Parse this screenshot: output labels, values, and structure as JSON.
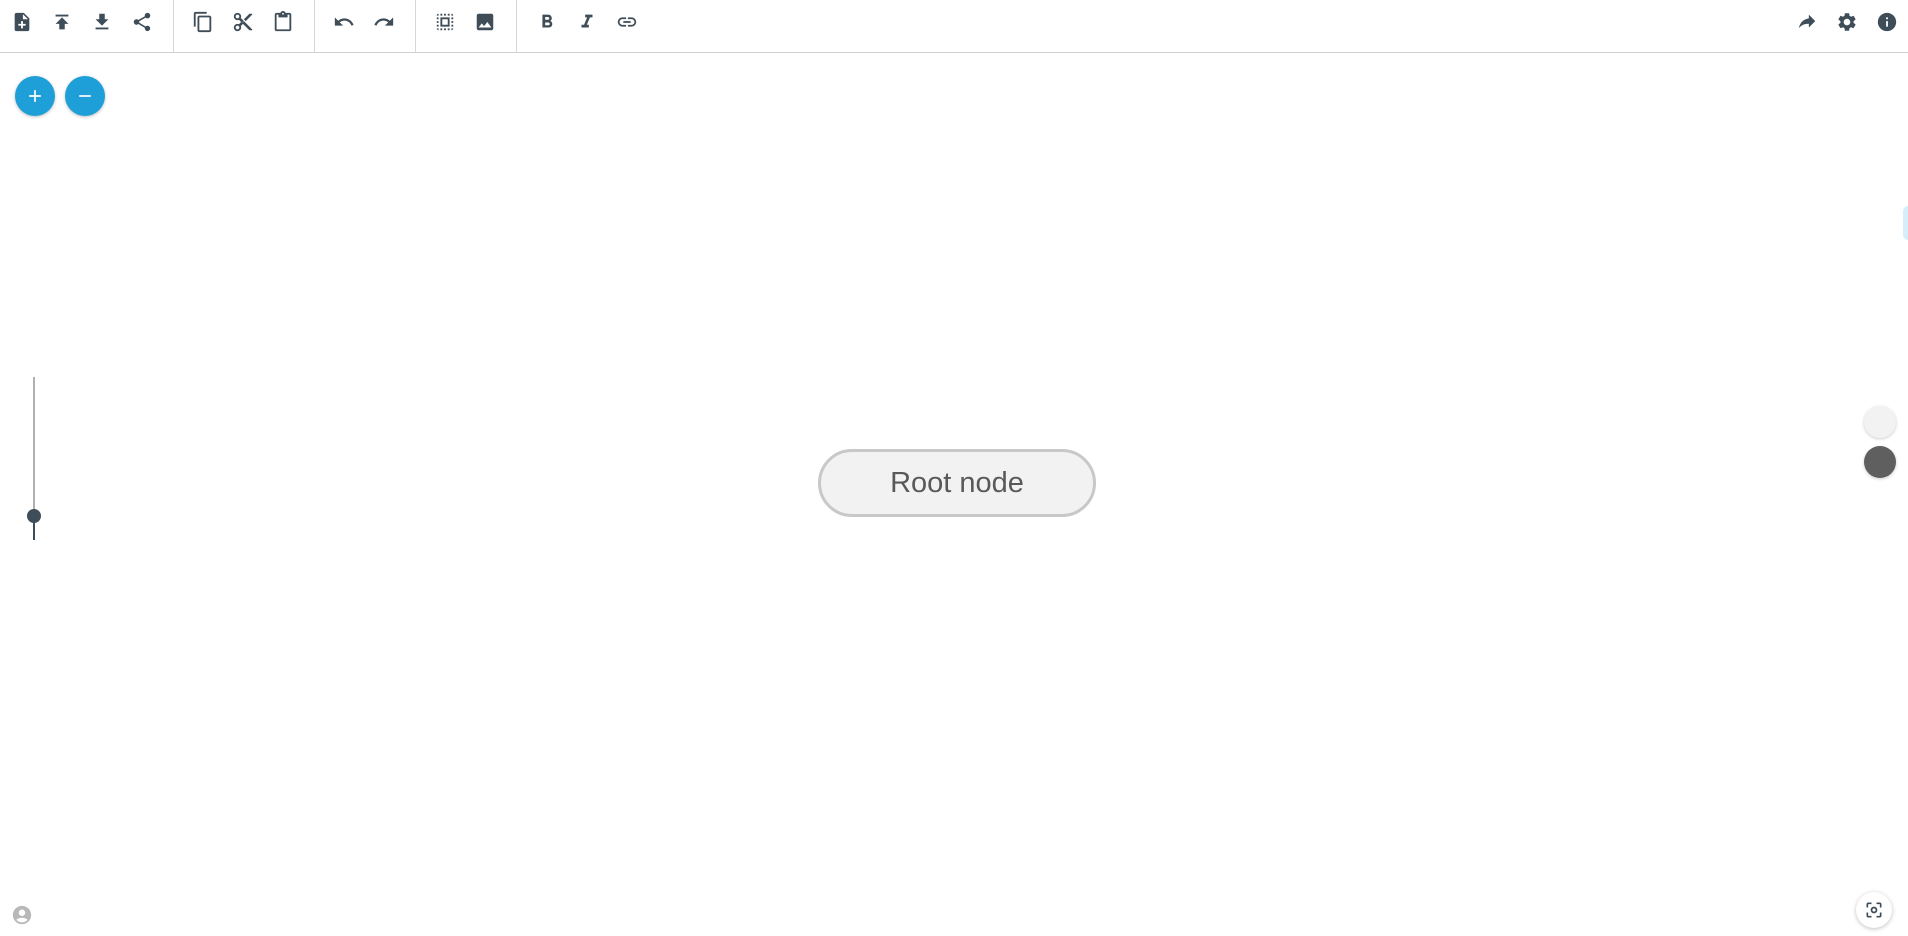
{
  "toolbar": {
    "groups": [
      {
        "name": "file",
        "items": [
          "new-map-icon",
          "upload-icon",
          "download-icon",
          "share-icon"
        ]
      },
      {
        "name": "clipboard",
        "items": [
          "copy-icon",
          "cut-icon",
          "paste-icon"
        ]
      },
      {
        "name": "history",
        "items": [
          "undo-icon",
          "redo-icon"
        ]
      },
      {
        "name": "insert",
        "items": [
          "select-all-icon",
          "image-icon"
        ]
      },
      {
        "name": "format",
        "items": [
          "bold-icon",
          "italic-icon",
          "link-icon"
        ]
      }
    ],
    "right_items": [
      "redo-forward-icon",
      "settings-icon",
      "info-icon"
    ]
  },
  "zoom": {
    "buttons": [
      "plus-icon",
      "minus-icon"
    ],
    "level": 0.15
  },
  "canvas": {
    "root_node_label": "Root node"
  },
  "themes": {
    "options": [
      "light",
      "dark"
    ],
    "colors": [
      "#f2f2f2",
      "#5f5f5f"
    ]
  },
  "colors": {
    "accent": "#1e9fd8",
    "icon": "#3f4d58"
  },
  "footer": {
    "left_icon": "account-icon",
    "right_icon": "focus-center-icon"
  }
}
